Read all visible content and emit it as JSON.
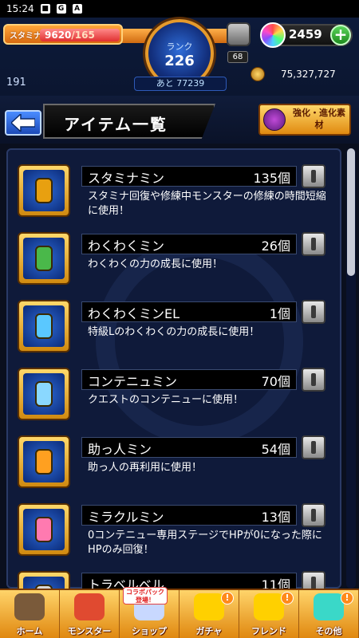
{
  "status_bar": {
    "time": "15:24",
    "icons": [
      "notification-icon",
      "google-icon",
      "app-a-icon"
    ]
  },
  "header": {
    "stamina_label": "スタミナ",
    "stamina_current": "9620",
    "stamina_max": "/165",
    "rank_label": "ランク",
    "rank_value": "226",
    "box_count": "68",
    "orbs": "2459",
    "exp_left": "191",
    "next_exp": "あと 77239",
    "coins": "75,327,727"
  },
  "title_row": {
    "title": "アイテム一覧",
    "evo_button": "強化・進化素材"
  },
  "items": [
    {
      "name": "スタミナミン",
      "count": "135個",
      "desc": "スタミナ回復や修練中モンスターの修練の時間短縮に使用！",
      "icon": "can-icon"
    },
    {
      "name": "わくわくミン",
      "count": "26個",
      "desc": "わくわくの力の成長に使用！",
      "icon": "sprout-bottle-icon"
    },
    {
      "name": "わくわくミンEL",
      "count": "1個",
      "desc": "特級Lのわくわくの力の成長に使用！",
      "icon": "el-bottle-icon"
    },
    {
      "name": "コンテニュミン",
      "count": "70個",
      "desc": "クエストのコンテニューに使用！",
      "icon": "continue-jar-icon"
    },
    {
      "name": "助っ人ミン",
      "count": "54個",
      "desc": "助っ人の再利用に使用！",
      "icon": "helper-bottle-icon"
    },
    {
      "name": "ミラクルミン",
      "count": "13個",
      "desc": "0コンテニュー専用ステージでHPが0になった際にHPのみ回復！",
      "icon": "heart-potion-icon"
    },
    {
      "name": "トラベルベル",
      "count": "11個",
      "desc": "",
      "icon": "bell-icon"
    }
  ],
  "bottom_nav": [
    {
      "label": "ホーム",
      "icon": "home-icon",
      "badge": ""
    },
    {
      "label": "モンスター",
      "icon": "monster-icon",
      "badge": ""
    },
    {
      "label": "ショップ",
      "icon": "shop-icon",
      "badge": ""
    },
    {
      "label": "ガチャ",
      "icon": "gacha-icon",
      "badge": "!"
    },
    {
      "label": "フレンド",
      "icon": "friend-icon",
      "badge": "!"
    },
    {
      "label": "その他",
      "icon": "other-icon",
      "badge": "!"
    }
  ],
  "collab_tag": "コラボパック登場！",
  "colors": {
    "accent": "#e08810",
    "panel": "#0f1a3a",
    "stamina": "#e03030"
  },
  "stamina_fill_fraction": 1.0
}
